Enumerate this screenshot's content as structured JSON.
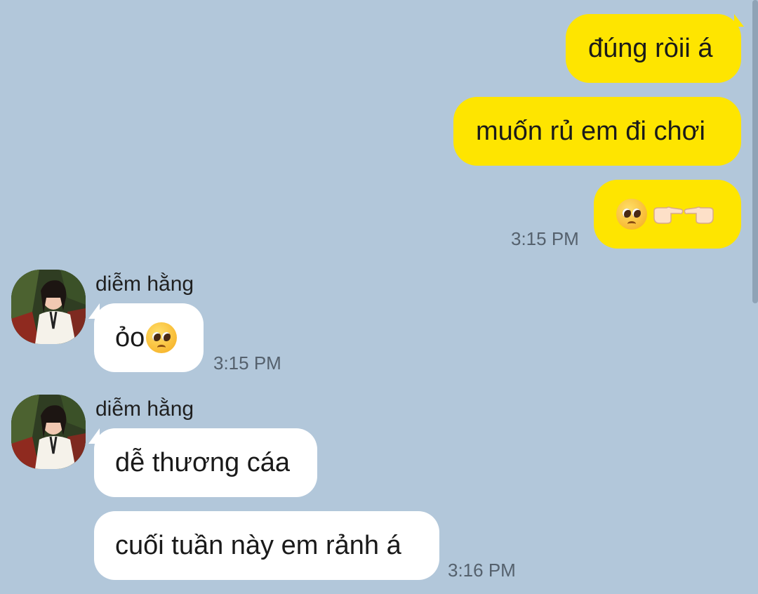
{
  "chat": {
    "outgoing": [
      {
        "text": "đúng ròii á"
      },
      {
        "text": "muốn rủ em đi chơi"
      },
      {
        "emoji": [
          "pleading-face-emoji",
          "finger-pointing-right-emoji",
          "finger-pointing-left-emoji"
        ]
      }
    ],
    "outgoing_time": "3:15 PM",
    "incoming_group_1": {
      "sender": "diễm hằng",
      "messages": [
        {
          "text": "ỏo",
          "emoji": "pleading-face-emoji"
        }
      ],
      "time": "3:15 PM"
    },
    "incoming_group_2": {
      "sender": "diễm hằng",
      "messages": [
        {
          "text": "dễ thương cáa"
        },
        {
          "text": "cuối tuần này em rảnh á"
        }
      ],
      "time": "3:16 PM"
    }
  },
  "colors": {
    "background": "#b2c7da",
    "outgoing_bubble": "#fee500",
    "incoming_bubble": "#ffffff",
    "timestamp": "#55616d"
  }
}
